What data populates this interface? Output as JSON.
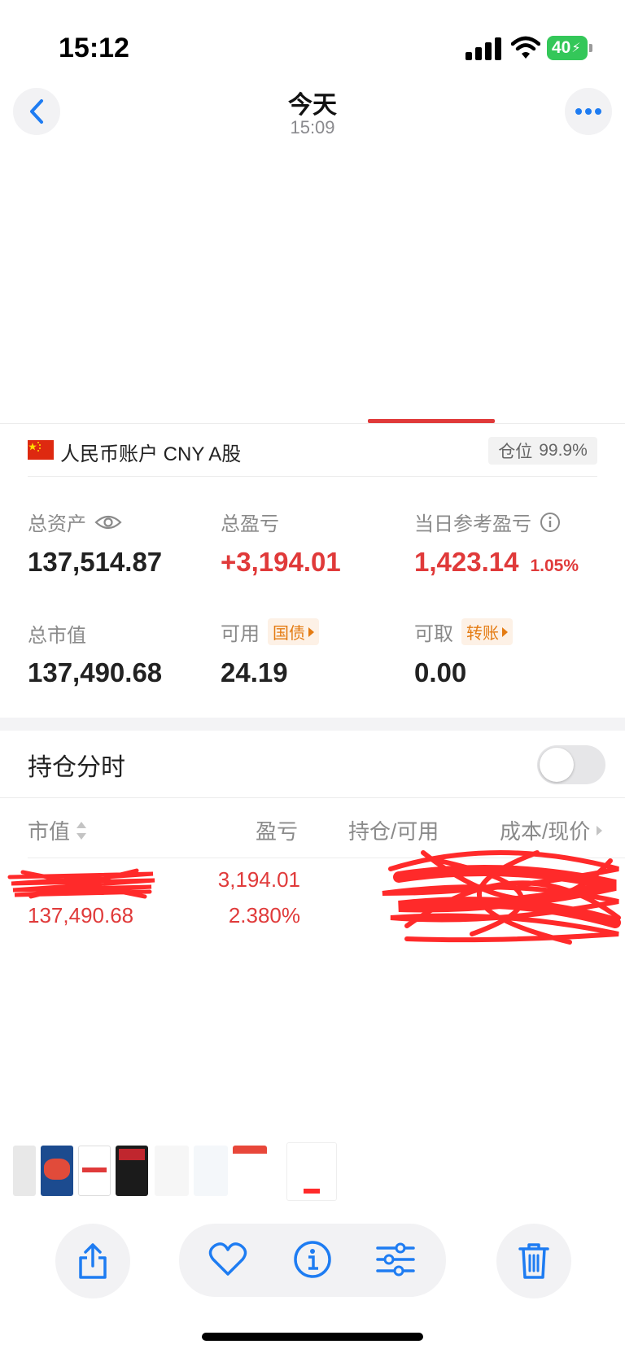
{
  "status_bar": {
    "time": "15:12",
    "battery": "40"
  },
  "nav": {
    "title": "今天",
    "subtitle": "15:09"
  },
  "account": {
    "name": "人民币账户 CNY A股",
    "position_label": "仓位",
    "position_value": "99.9%"
  },
  "stats": {
    "total_assets_label": "总资产",
    "total_assets_value": "137,514.87",
    "total_pl_label": "总盈亏",
    "total_pl_value": "+3,194.01",
    "daily_pl_label": "当日参考盈亏",
    "daily_pl_value": "1,423.14",
    "daily_pl_pct": "1.05%",
    "market_value_label": "总市值",
    "market_value": "137,490.68",
    "available_label": "可用",
    "available_tag": "国债",
    "available_value": "24.19",
    "withdrawable_label": "可取",
    "withdrawable_tag": "转账",
    "withdrawable_value": "0.00"
  },
  "holdings": {
    "section_title": "持仓分时",
    "toggle_on": false,
    "columns": [
      "市值",
      "盈亏",
      "持仓/可用",
      "成本/现价"
    ],
    "rows": [
      {
        "market_value": "137,490.68",
        "pl": "3,194.01",
        "pl_pct": "2.380%"
      }
    ]
  },
  "colors": {
    "red": "#e03a3a",
    "blue": "#1e7cf2",
    "orange": "#e47b12"
  },
  "icons": [
    "back-chevron-icon",
    "more-icon",
    "eye-icon",
    "info-icon",
    "share-icon",
    "heart-icon",
    "info-circle-icon",
    "adjust-icon",
    "trash-icon"
  ]
}
